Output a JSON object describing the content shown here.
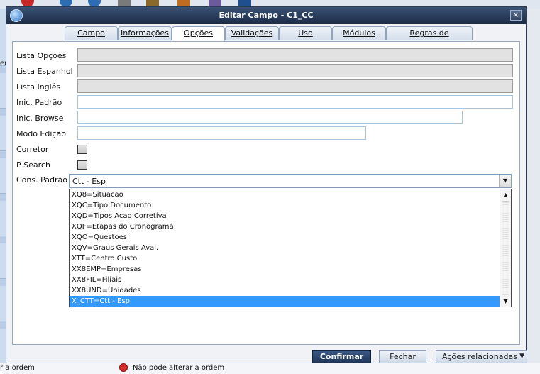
{
  "background": {
    "left_edge_label": "em",
    "bottom_left_text": "r a ordem",
    "bottom_status_text": "Não pode alterar a ordem"
  },
  "dialog": {
    "title": "Editar Campo - C1_CC",
    "close_glyph": "×"
  },
  "tabs": [
    {
      "label": "Campo"
    },
    {
      "label": "Informações"
    },
    {
      "label": "Opções",
      "active": true
    },
    {
      "label": "Validações"
    },
    {
      "label": "Uso"
    },
    {
      "label": "Módulos"
    },
    {
      "label": "Regras de dependência"
    }
  ],
  "form": {
    "lista_opcoes": {
      "label": "Lista Opçoes",
      "value": ""
    },
    "lista_espanhol": {
      "label": "Lista Espanhol",
      "value": ""
    },
    "lista_ingles": {
      "label": "Lista Inglês",
      "value": ""
    },
    "inic_padrao": {
      "label": "Inic. Padrão",
      "value": ""
    },
    "inic_browse": {
      "label": "Inic. Browse",
      "value": ""
    },
    "modo_edicao": {
      "label": "Modo Edição",
      "value": ""
    },
    "corretor": {
      "label": "Corretor",
      "checked": false
    },
    "p_search": {
      "label": "P Search",
      "checked": false
    },
    "cons_padrao": {
      "label": "Cons. Padrão",
      "value": "Ctt - Esp"
    }
  },
  "dropdown": {
    "options": [
      "XQ8=Situacao",
      "XQC=Tipo Documento",
      "XQD=Tipos Acao Corretiva",
      "XQF=Etapas do Cronograma",
      "XQO=Questoes",
      "XQV=Graus Gerais Aval.",
      "XTT=Centro Custo",
      "XX8EMP=Empresas",
      "XX8FIL=Filiais",
      "XX8UND=Unidades",
      "X_CTT=Ctt - Esp"
    ],
    "selected_index": 10
  },
  "buttons": {
    "confirm": "Confirmar",
    "close": "Fechar",
    "related_actions": "Ações relacionadas"
  },
  "colors": {
    "title_bar": "#24365a",
    "selection": "#3399ff",
    "primary_button": "#2a4670",
    "status_dot": "#d32f2f"
  },
  "icons": {
    "app": "app-globe-icon",
    "close": "close-icon",
    "combo_arrow": "chevron-down-icon",
    "status": "red-dot-icon"
  }
}
